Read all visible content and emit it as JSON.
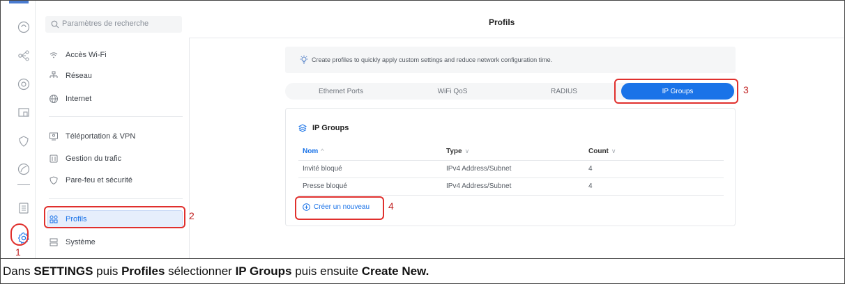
{
  "search": {
    "placeholder": "Paramètres de recherche"
  },
  "header": {
    "title": "Profils"
  },
  "sidebar": {
    "items": [
      {
        "label": "Accès Wi-Fi",
        "icon": "wifi-icon"
      },
      {
        "label": "Réseau",
        "icon": "network-icon"
      },
      {
        "label": "Internet",
        "icon": "globe-icon"
      },
      {
        "label": "Téléportation & VPN",
        "icon": "vpn-icon"
      },
      {
        "label": "Gestion du trafic",
        "icon": "traffic-icon"
      },
      {
        "label": "Pare-feu et sécurité",
        "icon": "shield-icon"
      },
      {
        "label": "Profils",
        "icon": "profiles-icon",
        "active": true
      },
      {
        "label": "Système",
        "icon": "system-icon"
      }
    ]
  },
  "info": {
    "text": "Create profiles to quickly apply custom settings and reduce network configuration time."
  },
  "tabs": [
    {
      "label": "Ethernet Ports"
    },
    {
      "label": "WiFi QoS"
    },
    {
      "label": "RADIUS"
    },
    {
      "label": "IP Groups",
      "active": true
    }
  ],
  "card": {
    "title": "IP Groups",
    "columns": [
      {
        "label": "Nom",
        "sort": "^"
      },
      {
        "label": "Type",
        "sort": "v"
      },
      {
        "label": "Count",
        "sort": "v"
      }
    ],
    "rows": [
      {
        "name": "Invité bloqué",
        "type": "IPv4 Address/Subnet",
        "count": "4"
      },
      {
        "name": "Presse bloqué",
        "type": "IPv4 Address/Subnet",
        "count": "4"
      }
    ],
    "create_label": "Créer un nouveau"
  },
  "annotations": {
    "n1": "1",
    "n2": "2",
    "n3": "3",
    "n4": "4"
  },
  "caption": {
    "p1": "Dans ",
    "b1": "SETTINGS",
    "p2": " puis ",
    "b2": "Profiles",
    "p3": " sélectionner ",
    "b3": "IP Groups",
    "p4": " puis ensuite ",
    "b4": "Create New."
  },
  "colors": {
    "accent": "#1a73e8",
    "annotation": "#e0302d"
  }
}
